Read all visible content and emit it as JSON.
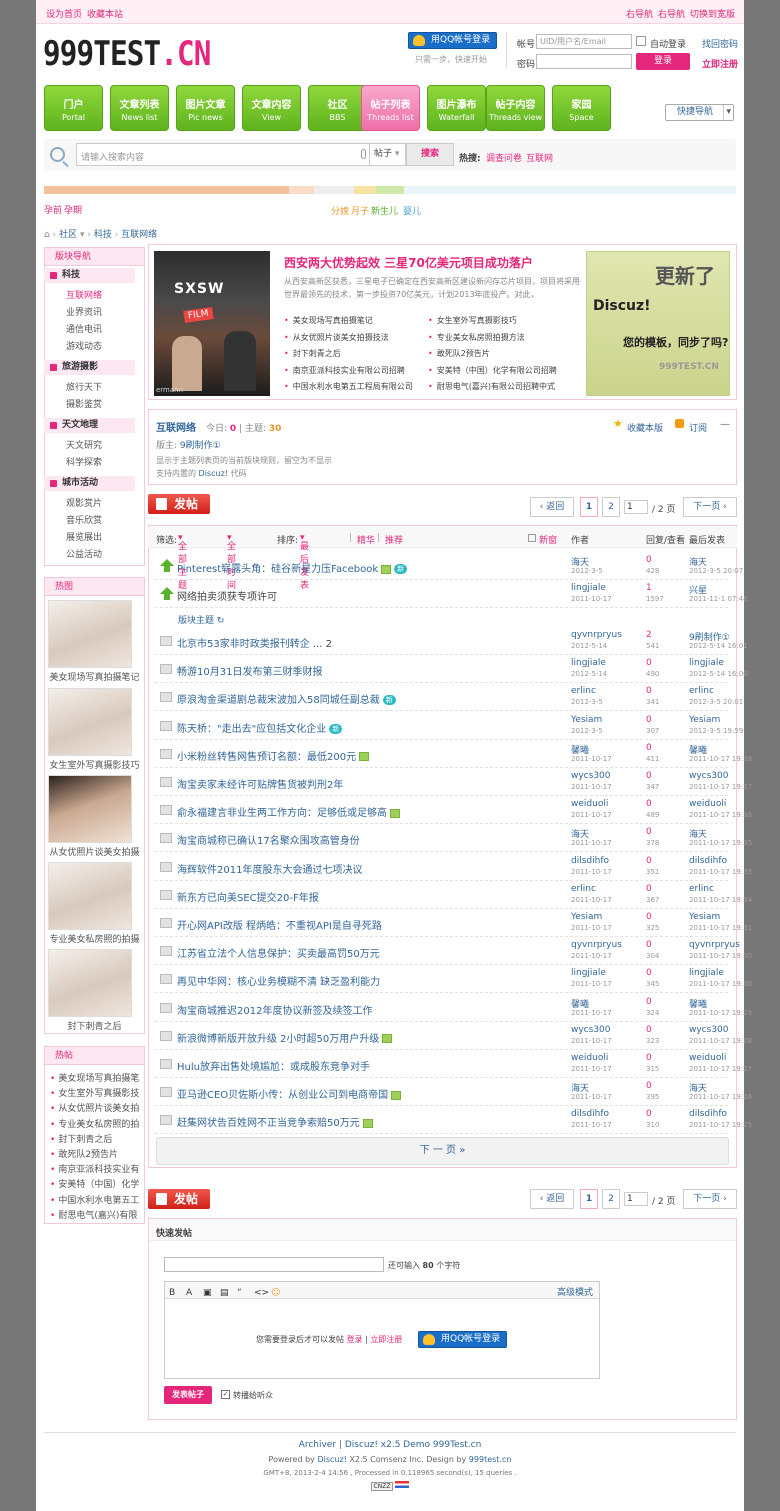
{
  "topbar": {
    "set_home": "设为首页",
    "bookmark": "收藏本站",
    "right_nav1": "右导航",
    "right_nav2": "右导航",
    "switch_width": "切换到宽版"
  },
  "logo": {
    "main": "999TEST",
    "suffix": ".CN"
  },
  "login": {
    "qq_button": "用QQ帐号登录",
    "qq_hint": "只需一步，快速开始",
    "account_label": "帐号",
    "account_placeholder": "UID/用户名/Email",
    "auto_login": "自动登录",
    "find_password": "找回密码",
    "password_label": "密码",
    "login_button": "登录",
    "register": "立即注册"
  },
  "nav": [
    {
      "title": "门户",
      "sub": "Portal"
    },
    {
      "title": "文章列表",
      "sub": "News list"
    },
    {
      "title": "图片文章",
      "sub": "Pic news"
    },
    {
      "title": "文章内容",
      "sub": "View"
    },
    {
      "title": "社区",
      "sub": "BBS"
    },
    {
      "title": "帖子列表",
      "sub": "Threads list"
    },
    {
      "title": "图片瀑布",
      "sub": "Waterfall"
    },
    {
      "title": "帖子内容",
      "sub": "Threads view"
    },
    {
      "title": "家园",
      "sub": "Space"
    }
  ],
  "quick_nav": "快捷导航",
  "search": {
    "placeholder": "请输入搜索内容",
    "type": "帖子",
    "button": "搜索",
    "hot_label": "热搜:",
    "hot1": "调查问卷",
    "hot2": "互联网"
  },
  "colorbar_colors": [
    "#f2c19b",
    "#f9dcc6",
    "#eee",
    "#f7e3a1",
    "#cfe7a9",
    "#e8f4f8"
  ],
  "tags": {
    "left1": "孕前",
    "left2": "孕期",
    "mid1": "分娩",
    "mid2": "月子",
    "mid3": "新生儿",
    "mid4": "婴儿"
  },
  "breadcrumb": {
    "home": "⌂",
    "c1": "社区",
    "c2": "科技",
    "c3": "互联网络"
  },
  "sidebar": {
    "title": "版块导航",
    "groups": [
      {
        "name": "科技",
        "items": [
          "互联网络",
          "业界资讯",
          "通信电讯",
          "游戏动态"
        ]
      },
      {
        "name": "旅游摄影",
        "items": [
          "旅行天下",
          "摄影鉴赏"
        ]
      },
      {
        "name": "天文地理",
        "items": [
          "天文研究",
          "科学探索"
        ]
      },
      {
        "name": "城市活动",
        "items": [
          "观影赏片",
          "音乐欣赏",
          "展览展出",
          "公益活动"
        ]
      }
    ],
    "hotpic_title": "热图",
    "hotpics": [
      "美女现场写真拍摄笔记",
      "女生室外写真摄影技巧",
      "从女优照片谈美女拍摄",
      "专业美女私房照的拍摄",
      "封下刺青之后"
    ],
    "hotpost_title": "热帖",
    "hotposts": [
      "美女现场写真拍摄笔",
      "女生室外写真摄影技",
      "从女优照片谈美女拍",
      "专业美女私房照的拍",
      "封下刺青之后",
      "敢死队2预告片",
      "南京亚派科技实业有",
      "安美特（中国）化学",
      "中国水利水电第五工",
      "耐思电气(嘉兴)有限"
    ]
  },
  "feature": {
    "img_text1": "SXSW",
    "img_text2": "FILM",
    "img_caption": "ermann",
    "title": "西安两大优势起效 三星70亿美元项目成功落户",
    "desc": "从西安高新区获悉，三星电子已确定在西安高新区建设新闪存芯片项目，项目将采用世界最领先的技术，第一步投资70亿美元，计划2013年底投产。对此，",
    "links_left": [
      "美女现场写真拍摄笔记",
      "从女优照片谈美女拍摄技法",
      "封下刺青之后",
      "南京亚派科技实业有限公司招聘",
      "中国水利水电第五工程局有限公司"
    ],
    "links_right": [
      "女生室外写真摄影技巧",
      "专业美女私房照拍摄方法",
      "敢死队2预告片",
      "安美特（中国）化学有限公司招聘",
      "耐思电气(嘉兴)有限公司招聘中式"
    ],
    "promo1": "更新了",
    "promo2": "Discuz!",
    "promo3": "您的模板，同步了吗?",
    "promo4": "999TEST.CN"
  },
  "forum": {
    "name": "互联网络",
    "today_label": "今日:",
    "today": "0",
    "topics_label": "主题:",
    "topics": "30",
    "favorite": "收藏本版",
    "subscribe": "订阅",
    "moderator_label": "版主:",
    "moderator": "9刷制作①",
    "rule1": "显示于主题列表页的当前版块规则，留空为不显示",
    "rule2_prefix": "支持内置的",
    "rule2_link": "Discuz!",
    "rule2_suffix": "代码"
  },
  "post_button": "发帖",
  "pager": {
    "back": "返回",
    "p1": "1",
    "p2": "2",
    "input": "1",
    "total": "/ 2 页",
    "next": "下一页"
  },
  "filters": {
    "label": "筛选:",
    "all_topics": "全部主题",
    "all_time": "全部时间",
    "sort_label": "排序:",
    "latest": "最后发表",
    "digest": "精华",
    "recommend": "推荐",
    "new_window": "新窗",
    "author": "作者",
    "reply_view": "回复/查看",
    "last_post": "最后发表"
  },
  "sticky": [
    {
      "subject": "Pinterest崭露头角：硅谷新星力压Facebook",
      "img": true,
      "new": true,
      "author": "海天",
      "date": "2012-3-5",
      "replies": "0",
      "views": "428",
      "last_user": "海天",
      "last_date": "2012-3-5 20:07"
    },
    {
      "subject": "网络拍卖须获专项许可",
      "img": false,
      "new": false,
      "author": "lingjiale",
      "date": "2011-10-17",
      "replies": "1",
      "views": "1597",
      "last_user": "兴星",
      "last_date": "2011-11-1 07:46"
    }
  ],
  "section_label": "版块主题",
  "threads": [
    {
      "subject": "北京市53家非时政类报刊转企",
      "pages": "... 2",
      "img": false,
      "new": false,
      "author": "qyvnrpryus",
      "date": "2012-5-14",
      "replies": "2",
      "views": "541",
      "last_user": "9刷制作①",
      "last_date": "2012-5-14 16:01"
    },
    {
      "subject": "畅游10月31日发布第三财季财报",
      "img": false,
      "new": false,
      "author": "lingjiale",
      "date": "2012-5-14",
      "replies": "0",
      "views": "490",
      "last_user": "lingjiale",
      "last_date": "2012-5-14 16:00"
    },
    {
      "subject": "原浪淘金渠道剧总裁宋波加入58同城任副总裁",
      "img": false,
      "new": true,
      "author": "erlinc",
      "date": "2012-3-5",
      "replies": "0",
      "views": "341",
      "last_user": "erlinc",
      "last_date": "2012-3-5 20:01"
    },
    {
      "subject": "陈天桥：\"走出去\"应包括文化企业",
      "img": false,
      "new": true,
      "author": "Yesiam",
      "date": "2012-3-5",
      "replies": "0",
      "views": "307",
      "last_user": "Yesiam",
      "last_date": "2012-3-5 19:59"
    },
    {
      "subject": "小米粉丝转售网售预订名额：最低200元",
      "img": true,
      "new": false,
      "author": "馨曦",
      "date": "2011-10-17",
      "replies": "0",
      "views": "411",
      "last_user": "馨曦",
      "last_date": "2011-10-17 19:38"
    },
    {
      "subject": "淘宝卖家未经许可贴牌售货被判刑2年",
      "img": false,
      "new": false,
      "author": "wycs300",
      "date": "2011-10-17",
      "replies": "0",
      "views": "347",
      "last_user": "wycs300",
      "last_date": "2011-10-17 19:37"
    },
    {
      "subject": "俞永福建言非业生两工作方向：足够低或足够高",
      "img": true,
      "new": false,
      "author": "weiduoli",
      "date": "2011-10-17",
      "replies": "0",
      "views": "489",
      "last_user": "weiduoli",
      "last_date": "2011-10-17 19:36"
    },
    {
      "subject": "淘宝商城称已确认17名聚众围攻高管身份",
      "img": false,
      "new": false,
      "author": "海天",
      "date": "2011-10-17",
      "replies": "0",
      "views": "378",
      "last_user": "海天",
      "last_date": "2011-10-17 19:35"
    },
    {
      "subject": "海辉软件2011年度股东大会通过七项决议",
      "img": false,
      "new": false,
      "author": "dilsdihfo",
      "date": "2011-10-17",
      "replies": "0",
      "views": "351",
      "last_user": "dilsdihfo",
      "last_date": "2011-10-17 19:35"
    },
    {
      "subject": "新东方已向美SEC提交20-F年报",
      "img": false,
      "new": false,
      "author": "erlinc",
      "date": "2011-10-17",
      "replies": "0",
      "views": "367",
      "last_user": "erlinc",
      "last_date": "2011-10-17 19:34"
    },
    {
      "subject": "开心网API改版 程炳皓：不重视API是自寻死路",
      "img": false,
      "new": false,
      "author": "Yesiam",
      "date": "2011-10-17",
      "replies": "0",
      "views": "325",
      "last_user": "Yesiam",
      "last_date": "2011-10-17 19:31"
    },
    {
      "subject": "江苏省立法个人信息保护：买卖最高罚50万元",
      "img": false,
      "new": false,
      "author": "qyvnrpryus",
      "date": "2011-10-17",
      "replies": "0",
      "views": "304",
      "last_user": "qyvnrpryus",
      "last_date": "2011-10-17 19:30"
    },
    {
      "subject": "再见中华网：核心业务模糊不清 缺乏盈利能力",
      "img": false,
      "new": false,
      "author": "lingjiale",
      "date": "2011-10-17",
      "replies": "0",
      "views": "345",
      "last_user": "lingjiale",
      "last_date": "2011-10-17 19:30"
    },
    {
      "subject": "淘宝商城推迟2012年度协议新签及续签工作",
      "img": false,
      "new": false,
      "author": "馨曦",
      "date": "2011-10-17",
      "replies": "0",
      "views": "324",
      "last_user": "馨曦",
      "last_date": "2011-10-17 19:29"
    },
    {
      "subject": "新浪微博新版开放升级 2小时超50万用户升级",
      "img": true,
      "new": false,
      "author": "wycs300",
      "date": "2011-10-17",
      "replies": "0",
      "views": "323",
      "last_user": "wycs300",
      "last_date": "2011-10-17 19:28"
    },
    {
      "subject": "Hulu放弃出售处境尴尬：或成股东竞争对手",
      "img": false,
      "new": false,
      "author": "weiduoli",
      "date": "2011-10-17",
      "replies": "0",
      "views": "315",
      "last_user": "weiduoli",
      "last_date": "2011-10-17 19:27"
    },
    {
      "subject": "亚马逊CEO贝佐斯小传：从创业公司到电商帝国",
      "img": true,
      "new": false,
      "author": "海天",
      "date": "2011-10-17",
      "replies": "0",
      "views": "395",
      "last_user": "海天",
      "last_date": "2011-10-17 19:26"
    },
    {
      "subject": "赶集网状告百姓网不正当竞争索赔50万元",
      "img": true,
      "new": false,
      "author": "dilsdihfo",
      "date": "2011-10-17",
      "replies": "0",
      "views": "310",
      "last_user": "dilsdihfo",
      "last_date": "2011-10-17 19:25"
    }
  ],
  "next_page": "下 一 页  »",
  "quickpost": {
    "title": "快速发帖",
    "remain_prefix": "还可输入",
    "remain_count": "80",
    "remain_suffix": "个字符",
    "advanced": "高级模式",
    "login_tip": "您需要登录后才可以发帖",
    "login": "登录",
    "register": "立即注册",
    "qq_button": "用QQ帐号登录",
    "submit": "发表帖子",
    "broadcast": "转播给听众",
    "tools": [
      "B",
      "A",
      "▣",
      "▤",
      "“",
      "<>",
      "☺"
    ]
  },
  "footer": {
    "archiver": "Archiver",
    "demo": "Discuz! x2.5 Demo 999Test.cn",
    "powered_prefix": "Powered by",
    "powered_link": "Discuz!",
    "powered_suffix": "X2.5 Comsenz Inc. Design by",
    "design_link": "999test.cn",
    "stats": "GMT+8, 2013-2-4 14:56 , Processed in 0.118965 second(s), 15 queries .",
    "cnzz": "CNZZ"
  }
}
